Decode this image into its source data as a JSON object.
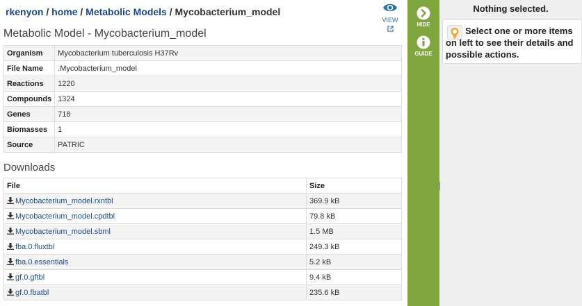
{
  "breadcrumb": {
    "user": "rkenyon",
    "home": "home",
    "folder": "Metabolic Models",
    "current": "Mycobacterium_model",
    "separator": "/"
  },
  "view_button": {
    "label": "VIEW",
    "icon": "eye-icon"
  },
  "model": {
    "title": "Metabolic Model - Mycobacterium_model",
    "properties": [
      {
        "key": "Organism",
        "value": "Mycobacterium tuberculosis H37Rv"
      },
      {
        "key": "File Name",
        "value": ".Mycobacterium_model"
      },
      {
        "key": "Reactions",
        "value": "1220"
      },
      {
        "key": "Compounds",
        "value": "1324"
      },
      {
        "key": "Genes",
        "value": "718"
      },
      {
        "key": "Biomasses",
        "value": "1"
      },
      {
        "key": "Source",
        "value": "PATRIC"
      }
    ]
  },
  "downloads": {
    "title": "Downloads",
    "headers": {
      "file": "File",
      "size": "Size"
    },
    "files": [
      {
        "name": "Mycobacterium_model.rxntbl",
        "size": "369.9 kB"
      },
      {
        "name": "Mycobacterium_model.cpdtbl",
        "size": "79.8 kB"
      },
      {
        "name": "Mycobacterium_model.sbml",
        "size": "1.5 MB"
      },
      {
        "name": "fba.0.fluxtbl",
        "size": "249.3 kB"
      },
      {
        "name": "fba.0.essentials",
        "size": "5.2 kB"
      },
      {
        "name": "gf.0.gftbl",
        "size": "9.4 kB"
      },
      {
        "name": "gf.0.fbatbl",
        "size": "235.6 kB"
      }
    ]
  },
  "toolbar": {
    "hide_label": "HIDE",
    "guide_label": "GUIDE",
    "color": "#7ea63c"
  },
  "panel": {
    "heading": "Nothing selected.",
    "hint": "Select one or more items on left to see their details and possible actions.",
    "hint_icon": "lightbulb-icon"
  }
}
